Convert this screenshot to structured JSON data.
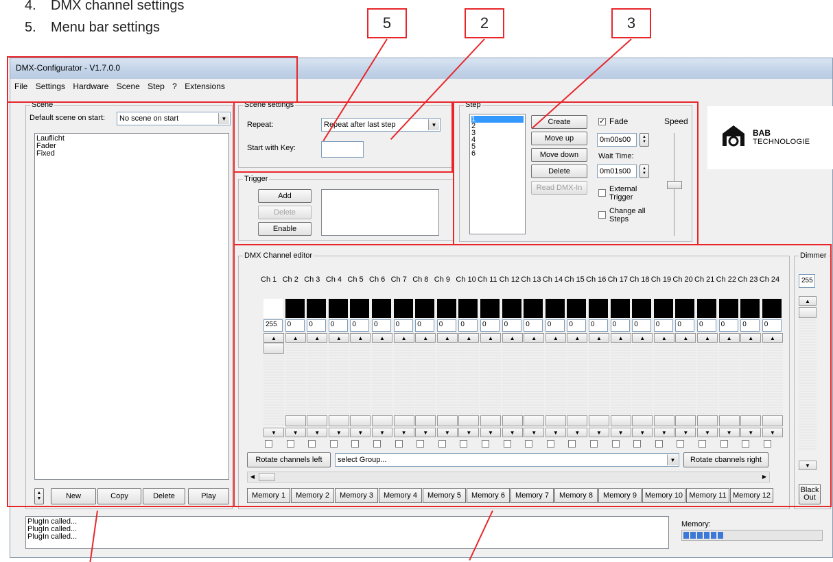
{
  "doc": {
    "items": [
      {
        "num": "4.",
        "text": "DMX channel settings"
      },
      {
        "num": "5.",
        "text": "Menu bar settings"
      }
    ],
    "callouts": [
      "5",
      "2",
      "3"
    ]
  },
  "window": {
    "title": "DMX-Configurator - V1.7.0.0",
    "menu": [
      "File",
      "Settings",
      "Hardware",
      "Scene",
      "Step",
      "?",
      "Extensions"
    ]
  },
  "scene": {
    "legend": "Scene",
    "default_label": "Default scene on start:",
    "default_value": "No scene on start",
    "items": [
      "Lauflicht",
      "Fader",
      "Fixed"
    ],
    "buttons": {
      "new": "New",
      "copy": "Copy",
      "delete": "Delete",
      "play": "Play"
    }
  },
  "scene_settings": {
    "legend": "Scene settings",
    "repeat_label": "Repeat:",
    "repeat_value": "Repeat after last step",
    "start_key_label": "Start with Key:",
    "start_key_value": ""
  },
  "trigger": {
    "legend": "Trigger",
    "buttons": {
      "add": "Add",
      "delete": "Delete",
      "enable": "Enable"
    }
  },
  "step": {
    "legend": "Step",
    "items": [
      "1",
      "2",
      "3",
      "4",
      "5",
      "6"
    ],
    "buttons": {
      "create": "Create",
      "move_up": "Move up",
      "move_down": "Move down",
      "delete": "Delete",
      "read_dmx": "Read DMX-In"
    },
    "fade_label": "Fade",
    "fade_checked": true,
    "fade_time": "0m00s00",
    "wait_label": "Wait Time:",
    "wait_time": "0m01s00",
    "external_trigger": "External Trigger",
    "change_all": "Change all Steps",
    "speed_label": "Speed"
  },
  "logo": {
    "line1": "BAB",
    "line2": "TECHNOLOGIE"
  },
  "dmx": {
    "legend": "DMX Channel editor",
    "channels": [
      {
        "label": "Ch 1",
        "value": "255",
        "color": "#ffffff"
      },
      {
        "label": "Ch 2",
        "value": "0",
        "color": "#000000"
      },
      {
        "label": "Ch 3",
        "value": "0",
        "color": "#000000"
      },
      {
        "label": "Ch 4",
        "value": "0",
        "color": "#000000"
      },
      {
        "label": "Ch 5",
        "value": "0",
        "color": "#000000"
      },
      {
        "label": "Ch 6",
        "value": "0",
        "color": "#000000"
      },
      {
        "label": "Ch 7",
        "value": "0",
        "color": "#000000"
      },
      {
        "label": "Ch 8",
        "value": "0",
        "color": "#000000"
      },
      {
        "label": "Ch 9",
        "value": "0",
        "color": "#000000"
      },
      {
        "label": "Ch 10",
        "value": "0",
        "color": "#000000"
      },
      {
        "label": "Ch 11",
        "value": "0",
        "color": "#000000"
      },
      {
        "label": "Ch 12",
        "value": "0",
        "color": "#000000"
      },
      {
        "label": "Ch 13",
        "value": "0",
        "color": "#000000"
      },
      {
        "label": "Ch 14",
        "value": "0",
        "color": "#000000"
      },
      {
        "label": "Ch 15",
        "value": "0",
        "color": "#000000"
      },
      {
        "label": "Ch 16",
        "value": "0",
        "color": "#000000"
      },
      {
        "label": "Ch 17",
        "value": "0",
        "color": "#000000"
      },
      {
        "label": "Ch 18",
        "value": "0",
        "color": "#000000"
      },
      {
        "label": "Ch 19",
        "value": "0",
        "color": "#000000"
      },
      {
        "label": "Ch 20",
        "value": "0",
        "color": "#000000"
      },
      {
        "label": "Ch 21",
        "value": "0",
        "color": "#000000"
      },
      {
        "label": "Ch 22",
        "value": "0",
        "color": "#000000"
      },
      {
        "label": "Ch 23",
        "value": "0",
        "color": "#000000"
      },
      {
        "label": "Ch 24",
        "value": "0",
        "color": "#000000"
      }
    ],
    "rotate_left": "Rotate channels left",
    "group_placeholder": "select Group...",
    "rotate_right": "Rotate cbannels right",
    "memories": [
      "Memory 1",
      "Memory 2",
      "Memory 3",
      "Memory 4",
      "Memory 5",
      "Memory 6",
      "Memory 7",
      "Memory 8",
      "Memory 9",
      "Memory 10",
      "Memory 11",
      "Memory 12"
    ]
  },
  "dimmer": {
    "legend": "Dimmer",
    "value": "255",
    "blackout": "Black Out"
  },
  "log": {
    "lines": [
      "PlugIn called...",
      "PlugIn called...",
      "PlugIn called..."
    ]
  },
  "memory": {
    "label": "Memory:",
    "filled_fraction": 0.3
  },
  "colors": {
    "annotation": "#e8262a",
    "progress": "#3b78d8"
  }
}
